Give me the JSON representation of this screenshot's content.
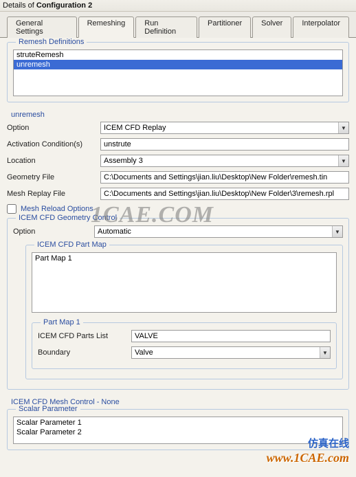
{
  "window": {
    "title_prefix": "Details of ",
    "title_name": "Configuration 2"
  },
  "tabs": {
    "t0": "General Settings",
    "t1": "Remeshing",
    "t2": "Run Definition",
    "t3": "Partitioner",
    "t4": "Solver",
    "t5": "Interpolator"
  },
  "remesh_definitions": {
    "legend": "Remesh Definitions",
    "items": {
      "i0": "struteRemesh",
      "i1": "unremesh"
    }
  },
  "current_remesh_label": "unremesh",
  "fields": {
    "option_label": "Option",
    "option_value": "ICEM CFD Replay",
    "activation_label": "Activation Condition(s)",
    "activation_value": "unstrute",
    "location_label": "Location",
    "location_value": "Assembly 3",
    "geometry_label": "Geometry File",
    "geometry_value": "C:\\Documents and Settings\\jian.liu\\Desktop\\New Folder\\remesh.tin",
    "meshreplay_label": "Mesh Replay File",
    "meshreplay_value": "C:\\Documents and Settings\\jian.liu\\Desktop\\New Folder\\3\\remesh.rpl",
    "mesh_reload_label": "Mesh Reload Options"
  },
  "geom_control": {
    "legend": "ICEM CFD Geometry Control",
    "option_label": "Option",
    "option_value": "Automatic"
  },
  "part_map": {
    "legend": "ICEM CFD Part Map",
    "item0": "Part Map 1",
    "sub_legend": "Part Map 1",
    "parts_list_label": "ICEM CFD Parts List",
    "parts_list_value": "VALVE",
    "boundary_label": "Boundary",
    "boundary_value": "Valve"
  },
  "mesh_control_legend": "ICEM CFD Mesh Control - None",
  "scalar_param": {
    "legend": "Scalar Parameter",
    "p0": "Scalar Parameter 1",
    "p1": "Scalar Parameter 2"
  },
  "branding": {
    "wm1": "1CAE.COM",
    "cn": "仿真在线",
    "wm2": "www.1CAE.com"
  }
}
